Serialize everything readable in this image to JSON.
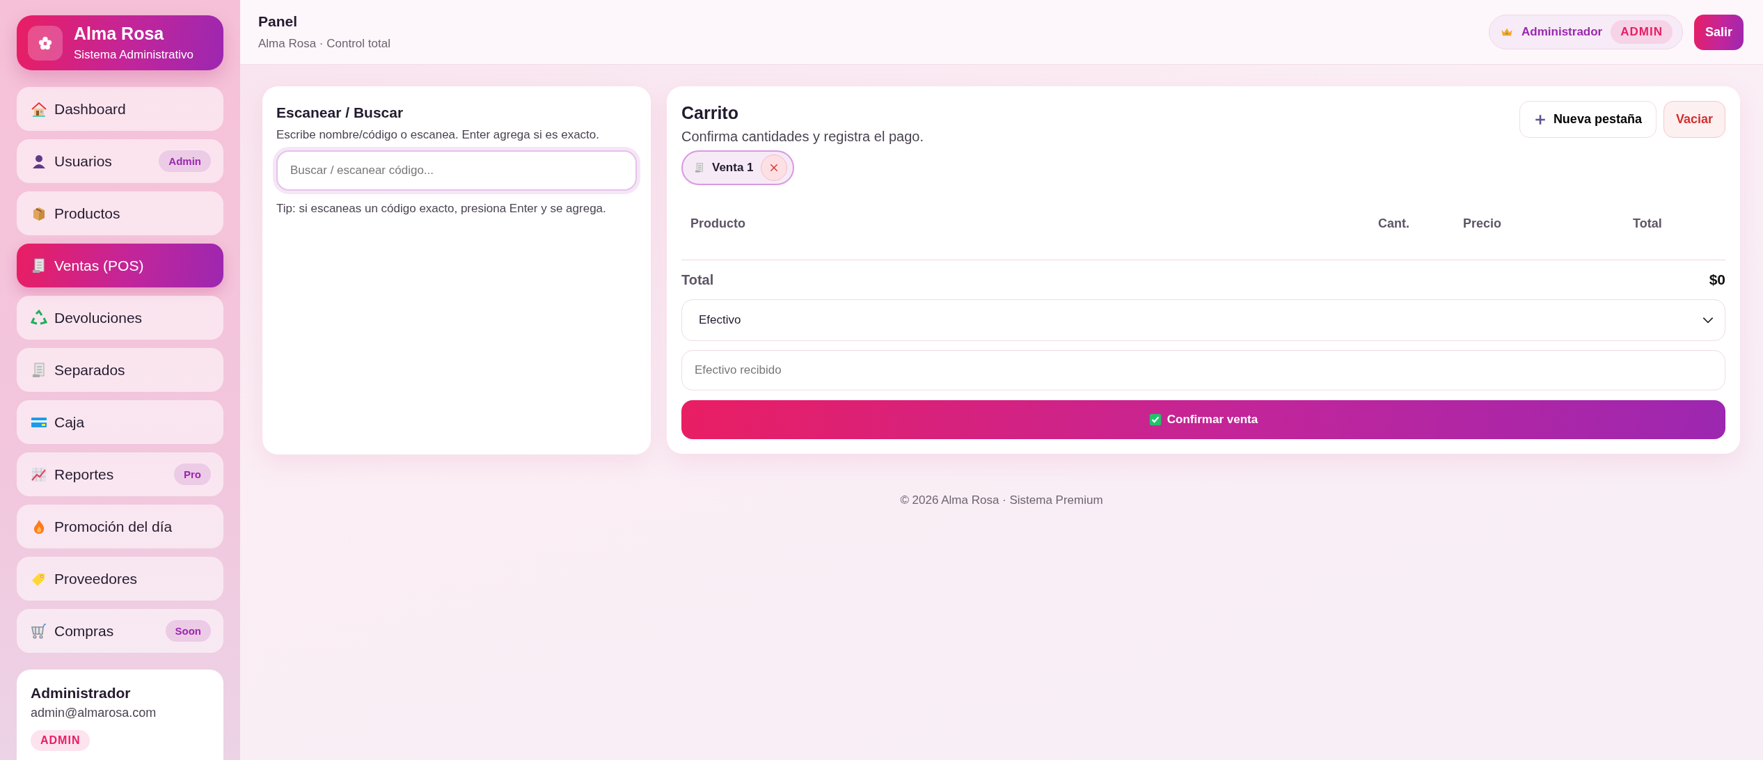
{
  "brand": {
    "title": "Alma Rosa",
    "subtitle": "Sistema Administrativo"
  },
  "sidebar": {
    "items": [
      {
        "label": "Dashboard",
        "selected": false
      },
      {
        "label": "Usuarios",
        "selected": false,
        "badge": "Admin"
      },
      {
        "label": "Productos",
        "selected": false
      },
      {
        "label": "Ventas (POS)",
        "selected": true
      },
      {
        "label": "Devoluciones",
        "selected": false
      },
      {
        "label": "Separados",
        "selected": false
      },
      {
        "label": "Caja",
        "selected": false
      },
      {
        "label": "Reportes",
        "selected": false,
        "badge": "Pro"
      },
      {
        "label": "Promoción del día",
        "selected": false
      },
      {
        "label": "Proveedores",
        "selected": false
      },
      {
        "label": "Compras",
        "selected": false,
        "badge": "Soon"
      }
    ],
    "user_card": {
      "name": "Administrador",
      "email": "admin@almarosa.com",
      "role": "ADMIN"
    }
  },
  "header": {
    "title": "Panel",
    "subtitle": "Alma Rosa · Control total",
    "user": {
      "name": "Administrador",
      "role": "ADMIN"
    },
    "logout": "Salir"
  },
  "search_panel": {
    "title": "Escanear / Buscar",
    "hint": "Escribe nombre/código o escanea. Enter agrega si es exacto.",
    "placeholder": "Buscar / escanear código...",
    "tip": "Tip: si escaneas un código exacto, presiona Enter y se agrega."
  },
  "cart": {
    "title": "Carrito",
    "subtitle": "Confirma cantidades y registra el pago.",
    "new_tab": "Nueva pestaña",
    "clear": "Vaciar",
    "tabs": [
      {
        "label": "Venta 1",
        "selected": true
      }
    ],
    "columns": [
      "Producto",
      "Cant.",
      "Precio",
      "Total"
    ],
    "total_label": "Total",
    "total_value": "$0",
    "payment_method": "Efectivo",
    "cash_placeholder": "Efectivo recibido",
    "confirm": "Confirmar venta"
  },
  "footer": "© 2026 Alma Rosa · Sistema Premium"
}
